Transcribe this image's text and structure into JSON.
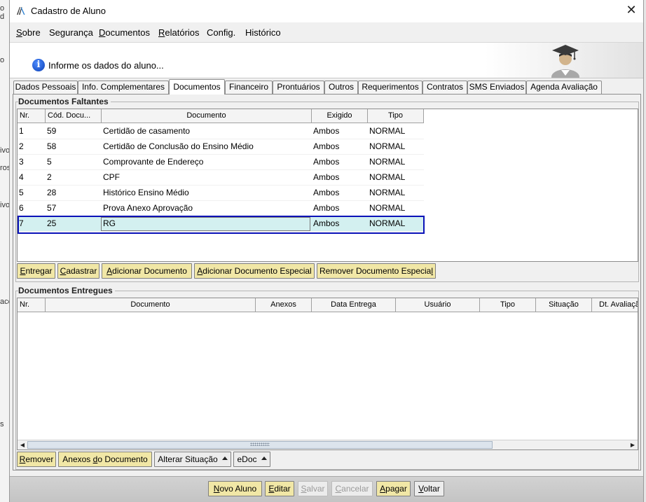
{
  "window": {
    "title": "Cadastro de Aluno"
  },
  "background": {
    "left_fragments": [
      "o d",
      "o",
      "ivo",
      "ros",
      "ivo",
      "acc",
      "s"
    ]
  },
  "menu": [
    {
      "label": "Sobre",
      "mnemonic": "S",
      "rest": "obre"
    },
    {
      "label": "Segurança",
      "mnemonic": "",
      "rest": "Segurança"
    },
    {
      "label": "Documentos",
      "mnemonic": "D",
      "rest": "ocumentos"
    },
    {
      "label": "Relatórios",
      "mnemonic": "R",
      "rest": "elatórios"
    },
    {
      "label": "Config.",
      "mnemonic": "",
      "rest": "Config."
    },
    {
      "label": "Histórico",
      "mnemonic": "",
      "rest": "Histórico"
    }
  ],
  "info": {
    "text": "Informe os dados do aluno..."
  },
  "tabs": [
    "Dados Pessoais",
    "Info. Complementares",
    "Documentos",
    "Financeiro",
    "Prontuários",
    "Outros",
    "Requerimentos",
    "Contratos",
    "SMS Enviados",
    "Agenda Avaliação"
  ],
  "active_tab": "Documentos",
  "faltantes": {
    "title": "Documentos Faltantes",
    "columns": [
      "Nr.",
      "Cód. Docu...",
      "Documento",
      "Exigido",
      "Tipo"
    ],
    "rows": [
      [
        "1",
        "59",
        "Certidão de casamento",
        "Ambos",
        "NORMAL"
      ],
      [
        "2",
        "58",
        "Certidão de Conclusão do Ensino Médio",
        "Ambos",
        "NORMAL"
      ],
      [
        "3",
        "5",
        "Comprovante de Endereço",
        "Ambos",
        "NORMAL"
      ],
      [
        "4",
        "2",
        "CPF",
        "Ambos",
        "NORMAL"
      ],
      [
        "5",
        "28",
        "Histórico Ensino Médio",
        "Ambos",
        "NORMAL"
      ],
      [
        "6",
        "57",
        "Prova Anexo Aprovação",
        "Ambos",
        "NORMAL"
      ],
      [
        "7",
        "25",
        "RG",
        "Ambos",
        "NORMAL"
      ]
    ],
    "selected_row": "7",
    "buttons": {
      "entregar": {
        "m": "E",
        "r": "ntregar"
      },
      "cadastrar": {
        "m": "C",
        "r": "adastrar"
      },
      "adicionar": {
        "m": "A",
        "r": "dicionar Documento"
      },
      "adicionar_especial": {
        "m": "A",
        "r": "dicionar Documento Especial"
      },
      "remover_especial": {
        "a": "Remover Documento Especia",
        "m": "l",
        "r": ""
      }
    }
  },
  "entregues": {
    "title": "Documentos Entregues",
    "columns": [
      "Nr.",
      "Documento",
      "Anexos",
      "Data Entrega",
      "Usuário",
      "Tipo",
      "Situação",
      "Dt. Avaliaçã"
    ],
    "buttons": {
      "remover": {
        "m": "R",
        "r": "emover"
      },
      "anexos": {
        "a": "Anexos ",
        "m": "d",
        "r": "o Documento"
      },
      "alterar": "Alterar Situação",
      "edoc": "eDoc"
    }
  },
  "footer": {
    "novo": {
      "m": "N",
      "r": "ovo Aluno"
    },
    "editar": {
      "m": "E",
      "r": "ditar"
    },
    "salvar": {
      "m": "S",
      "r": "alvar"
    },
    "cancelar": {
      "m": "C",
      "r": "ancelar"
    },
    "apagar": {
      "m": "A",
      "r": "pagar"
    },
    "voltar": {
      "m": "V",
      "r": "oltar"
    }
  },
  "colors": {
    "button_bg": "#f1e7a6",
    "selected_row": "#d3f0f0",
    "selection_border": "#0a12b8",
    "info_icon": "#0b3fb5"
  }
}
